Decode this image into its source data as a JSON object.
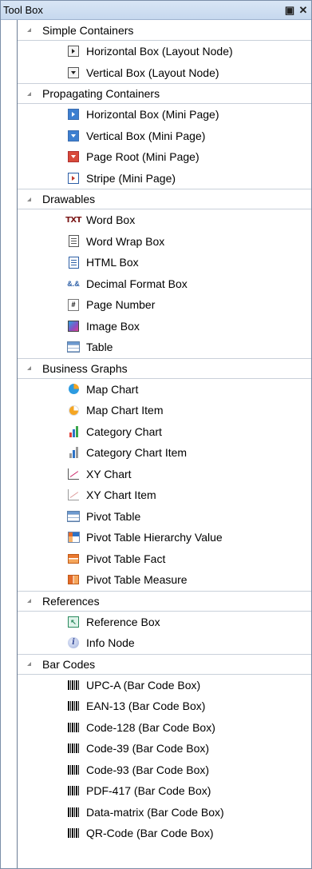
{
  "window": {
    "title": "Tool Box",
    "pin_glyph": "ȸ",
    "close_glyph": "✕"
  },
  "groups": [
    {
      "label": "Simple Containers",
      "items": [
        {
          "label": "Horizontal Box (Layout Node)",
          "icon": "horizontal-box-icon"
        },
        {
          "label": "Vertical Box (Layout Node)",
          "icon": "vertical-box-icon"
        }
      ]
    },
    {
      "label": "Propagating Containers",
      "items": [
        {
          "label": "Horizontal Box (Mini Page)",
          "icon": "horizontal-mini-page-icon"
        },
        {
          "label": "Vertical Box (Mini Page)",
          "icon": "vertical-mini-page-icon"
        },
        {
          "label": "Page Root (Mini Page)",
          "icon": "page-root-icon"
        },
        {
          "label": "Stripe (Mini Page)",
          "icon": "stripe-icon"
        }
      ]
    },
    {
      "label": "Drawables",
      "items": [
        {
          "label": "Word Box",
          "icon": "word-box-icon",
          "glyph": "TXT"
        },
        {
          "label": "Word Wrap Box",
          "icon": "word-wrap-box-icon"
        },
        {
          "label": "HTML Box",
          "icon": "html-box-icon"
        },
        {
          "label": "Decimal Format Box",
          "icon": "decimal-format-icon",
          "glyph": "&.&"
        },
        {
          "label": "Page Number",
          "icon": "page-number-icon",
          "glyph": "#"
        },
        {
          "label": "Image Box",
          "icon": "image-box-icon"
        },
        {
          "label": "Table",
          "icon": "table-icon"
        }
      ]
    },
    {
      "label": "Business Graphs",
      "items": [
        {
          "label": "Map Chart",
          "icon": "pie-chart-icon"
        },
        {
          "label": "Map Chart Item",
          "icon": "pie-chart-item-icon"
        },
        {
          "label": "Category Chart",
          "icon": "bar-chart-icon"
        },
        {
          "label": "Category Chart Item",
          "icon": "bar-chart-item-icon"
        },
        {
          "label": "XY Chart",
          "icon": "xy-chart-icon"
        },
        {
          "label": "XY Chart Item",
          "icon": "xy-chart-item-icon"
        },
        {
          "label": "Pivot Table",
          "icon": "pivot-table-icon"
        },
        {
          "label": "Pivot Table Hierarchy Value",
          "icon": "pivot-hierarchy-icon"
        },
        {
          "label": "Pivot Table Fact",
          "icon": "pivot-fact-icon"
        },
        {
          "label": "Pivot Table Measure",
          "icon": "pivot-measure-icon"
        }
      ]
    },
    {
      "label": "References",
      "items": [
        {
          "label": "Reference Box",
          "icon": "reference-box-icon"
        },
        {
          "label": "Info Node",
          "icon": "info-icon",
          "glyph": "i"
        }
      ]
    },
    {
      "label": "Bar Codes",
      "items": [
        {
          "label": "UPC-A (Bar Code Box)",
          "icon": "barcode-icon"
        },
        {
          "label": "EAN-13 (Bar Code Box)",
          "icon": "barcode-icon"
        },
        {
          "label": "Code-128 (Bar Code Box)",
          "icon": "barcode-icon"
        },
        {
          "label": "Code-39 (Bar Code Box)",
          "icon": "barcode-icon"
        },
        {
          "label": "Code-93 (Bar Code Box)",
          "icon": "barcode-icon"
        },
        {
          "label": "PDF-417 (Bar Code Box)",
          "icon": "barcode-icon"
        },
        {
          "label": "Data-matrix (Bar Code Box)",
          "icon": "barcode-icon"
        },
        {
          "label": "QR-Code (Bar Code Box)",
          "icon": "barcode-icon"
        }
      ]
    }
  ]
}
